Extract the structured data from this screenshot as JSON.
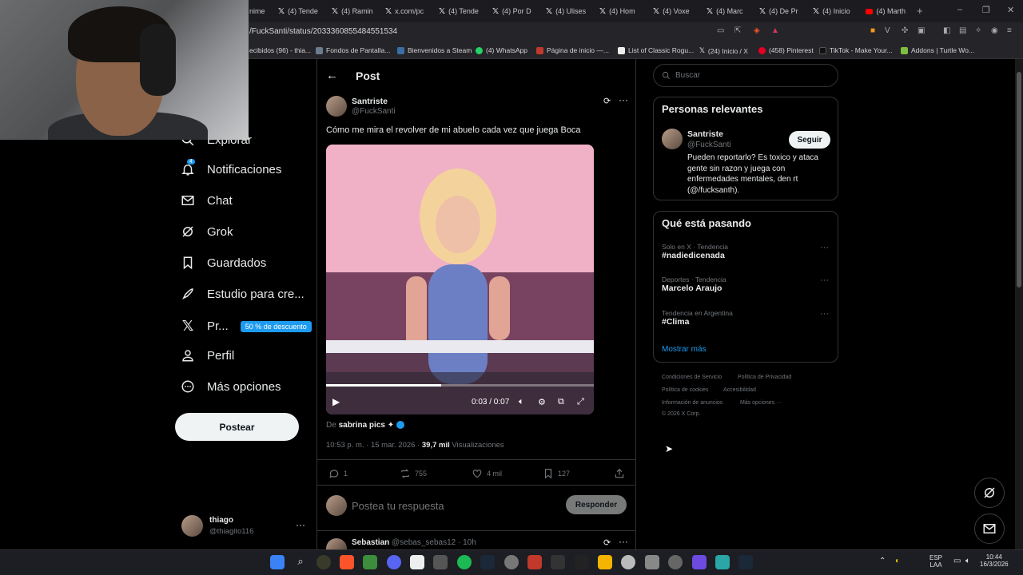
{
  "browser": {
    "tabs": [
      "nime",
      "(4) Tende",
      "(4) Ramin",
      "x.com/pc",
      "(4) Tende",
      "(4) Por D",
      "(4) Ulises",
      "(4) Hom",
      "(4) Voxe",
      "(4) Marc",
      "(4) De Pr",
      "(4) Inicio",
      "(4) Marth"
    ],
    "url": "/FuckSanti/status/2033360855484551534",
    "bookmarks": [
      "ecibidos (96) - thia...",
      "Fondos de Pantalla...",
      "Bienvenidos a Steam",
      "(4) WhatsApp",
      "Página de inicio —...",
      "List of Classic Rogu...",
      "(24) Inicio / X",
      "(458) Pinterest",
      "TikTok - Make Your...",
      "Addons | Turtle Wo..."
    ]
  },
  "nav": {
    "explore_label": "Explorar",
    "notif_badge": "4",
    "items": [
      "Notificaciones",
      "Chat",
      "Grok",
      "Guardados",
      "Estudio para cre...",
      "Pr...",
      "Perfil",
      "Más opciones"
    ],
    "premium_promo": "50 % de descuento",
    "post_button": "Postear",
    "user_name": "thiago",
    "user_handle": "@thiagito116"
  },
  "header": {
    "title": "Post"
  },
  "post": {
    "author_name": "Santriste",
    "author_handle": "@FuckSanti",
    "text": "Cómo me mira el revolver de mi abuelo cada vez que juega Boca",
    "video_time": "0:03 / 0:07",
    "video_progress": 0.43,
    "source_prefix": "De",
    "source_name": "sabrina pics ✦",
    "timestamp": "10:53 p. m. · 15 mar. 2026 ·",
    "views_count": "39,7 mil",
    "views_label": "Visualizaciones",
    "replies": "1",
    "reposts": "755",
    "likes": "4 mil",
    "bookmarks": "127"
  },
  "reply_box": {
    "placeholder": "Postea tu respuesta",
    "button": "Responder"
  },
  "next_reply": {
    "name": "Sebastian",
    "handle": "@sebas_sebas12 · 10h"
  },
  "sidebar": {
    "search_placeholder": "Buscar",
    "relevant_title": "Personas relevantes",
    "relevant_name": "Santriste",
    "relevant_handle": "@FuckSanti",
    "follow_button": "Seguir",
    "relevant_bio": "Pueden reportarlo? Es toxico y ataca gente sin razon y juega con enfermedades mentales, den rt (@/fucksanth).",
    "trending_title": "Qué está pasando",
    "trends": [
      {
        "meta": "Solo en X · Tendencia",
        "name": "#nadiedicenada"
      },
      {
        "meta": "Deportes · Tendencia",
        "name": "Marcelo Araujo"
      },
      {
        "meta": "Tendencia en Argentina",
        "name": "#Clima"
      }
    ],
    "show_more": "Mostrar más",
    "footer": [
      "Condiciones de Servicio",
      "Política de Privacidad",
      "Política de cookies",
      "Accesibilidad",
      "Información de anuncios",
      "Más opciones ···",
      "© 2026 X Corp."
    ]
  },
  "taskbar": {
    "lang1": "ESP",
    "lang2": "LAA",
    "time": "10:44",
    "date": "16/3/2026"
  }
}
